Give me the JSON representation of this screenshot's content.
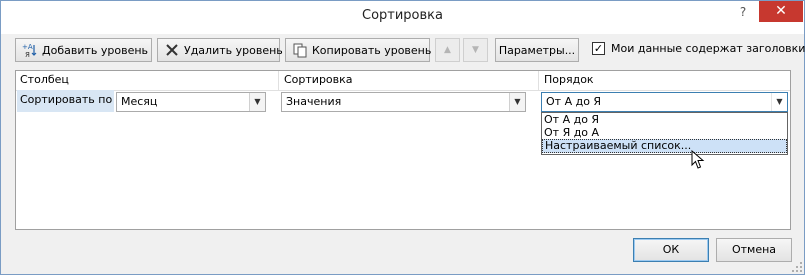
{
  "window": {
    "title": "Сортировка",
    "help": "?",
    "close": "✕"
  },
  "toolbar": {
    "add_level": "Добавить уровень",
    "delete_level": "Удалить уровень",
    "copy_level": "Копировать уровень",
    "move_up": "▲",
    "move_down": "▼",
    "options": "Параметры...",
    "headers_checkbox_label": "Мои данные содержат заголовки",
    "headers_checked": true
  },
  "grid": {
    "columns": [
      "Столбец",
      "Сортировка",
      "Порядок"
    ],
    "row": {
      "label": "Сортировать по",
      "column_value": "Месяц",
      "sort_on_value": "Значения",
      "order_value": "От А до Я"
    },
    "order_options": [
      "От А до Я",
      "От Я до А",
      "Настраиваемый список..."
    ],
    "order_highlighted_index": 2
  },
  "footer": {
    "ok": "ОК",
    "cancel": "Отмена"
  },
  "colors": {
    "close_button": "#c7382f",
    "selection": "#cde1f7",
    "row_label_bg": "#d8e6f4"
  }
}
